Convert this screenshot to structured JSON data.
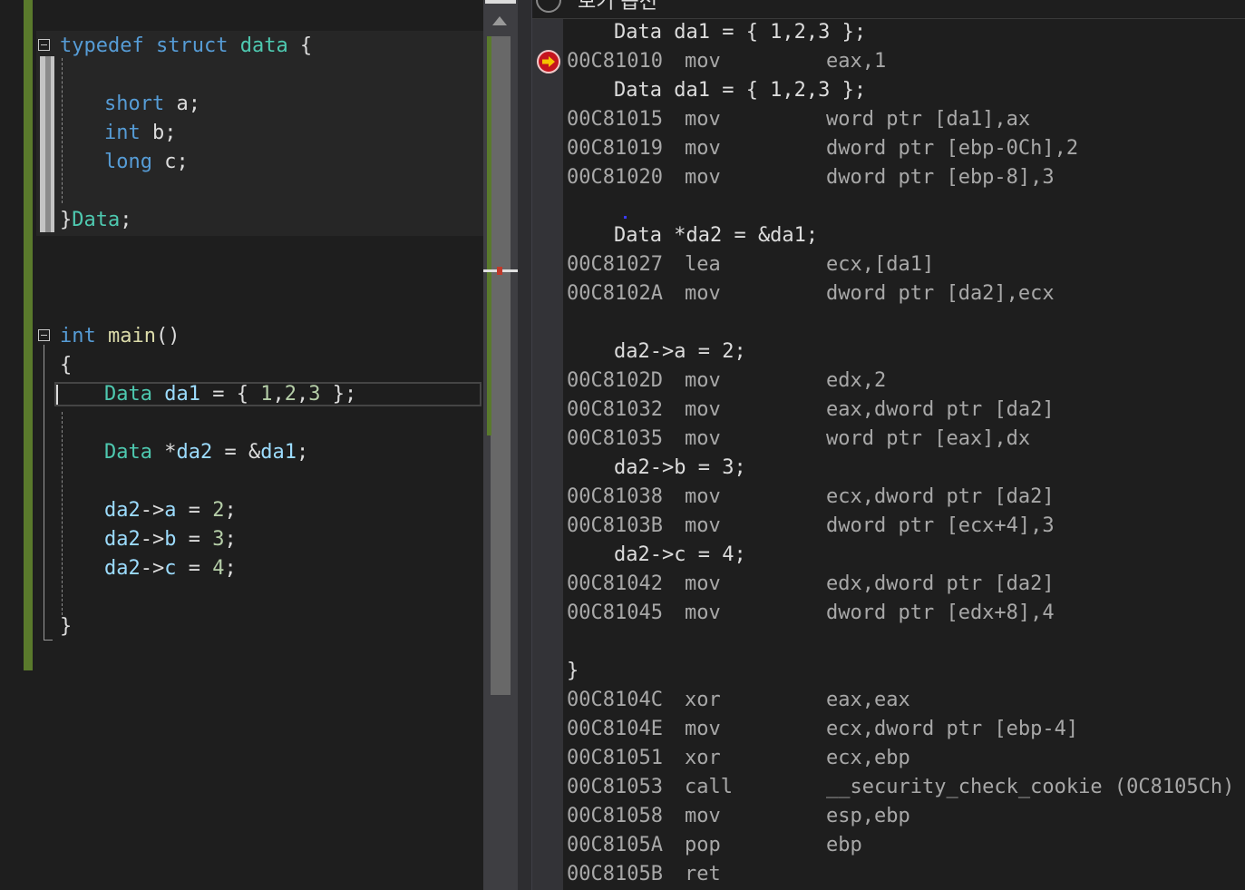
{
  "editor": {
    "lines": [
      {
        "id": "typedef",
        "tokens": [
          [
            "kw",
            "typedef"
          ],
          [
            "pl",
            " "
          ],
          [
            "kw",
            "struct"
          ],
          [
            "pl",
            " "
          ],
          [
            "ty",
            "data"
          ],
          [
            "pl",
            " {"
          ]
        ]
      },
      {
        "id": "short",
        "tokens": [
          [
            "kw",
            "short"
          ],
          [
            "pl",
            " a;"
          ]
        ]
      },
      {
        "id": "int-b",
        "tokens": [
          [
            "kw",
            "int"
          ],
          [
            "pl",
            " b;"
          ]
        ]
      },
      {
        "id": "long",
        "tokens": [
          [
            "kw",
            "long"
          ],
          [
            "pl",
            " c;"
          ]
        ]
      },
      {
        "id": "close-struct",
        "tokens": [
          [
            "pl",
            "}"
          ],
          [
            "ty",
            "Data"
          ],
          [
            "pl",
            ";"
          ]
        ]
      },
      {
        "id": "main",
        "tokens": [
          [
            "kw",
            "int"
          ],
          [
            "pl",
            " "
          ],
          [
            "fn",
            "main"
          ],
          [
            "pl",
            "()"
          ]
        ]
      },
      {
        "id": "open-brace",
        "tokens": [
          [
            "pl",
            "{"
          ]
        ]
      },
      {
        "id": "da1",
        "tokens": [
          [
            "ty",
            "Data"
          ],
          [
            "pl",
            " "
          ],
          [
            "var",
            "da1"
          ],
          [
            "pl",
            " = { "
          ],
          [
            "num",
            "1"
          ],
          [
            "pl",
            ","
          ],
          [
            "num",
            "2"
          ],
          [
            "pl",
            ","
          ],
          [
            "num",
            "3"
          ],
          [
            "pl",
            " };"
          ]
        ]
      },
      {
        "id": "da2",
        "tokens": [
          [
            "ty",
            "Data"
          ],
          [
            "pl",
            " *"
          ],
          [
            "var",
            "da2"
          ],
          [
            "pl",
            " = &"
          ],
          [
            "var",
            "da1"
          ],
          [
            "pl",
            ";"
          ]
        ]
      },
      {
        "id": "assign-a",
        "tokens": [
          [
            "var",
            "da2"
          ],
          [
            "pl",
            "->"
          ],
          [
            "var",
            "a"
          ],
          [
            "pl",
            " = "
          ],
          [
            "num",
            "2"
          ],
          [
            "pl",
            ";"
          ]
        ]
      },
      {
        "id": "assign-b",
        "tokens": [
          [
            "var",
            "da2"
          ],
          [
            "pl",
            "->"
          ],
          [
            "var",
            "b"
          ],
          [
            "pl",
            " = "
          ],
          [
            "num",
            "3"
          ],
          [
            "pl",
            ";"
          ]
        ]
      },
      {
        "id": "assign-c",
        "tokens": [
          [
            "var",
            "da2"
          ],
          [
            "pl",
            "->"
          ],
          [
            "var",
            "c"
          ],
          [
            "pl",
            " = "
          ],
          [
            "num",
            "4"
          ],
          [
            "pl",
            ";"
          ]
        ]
      },
      {
        "id": "close-main",
        "tokens": [
          [
            "pl",
            "}"
          ]
        ]
      }
    ]
  },
  "disassembly": {
    "header_label": "보기 옵션",
    "rows": [
      {
        "kind": "src",
        "text": "Data da1 = { 1,2,3 };"
      },
      {
        "kind": "asm",
        "addr": "00C81010",
        "mnemonic": "mov",
        "operands": "eax,1",
        "current": true
      },
      {
        "kind": "src",
        "text": "Data da1 = { 1,2,3 };"
      },
      {
        "kind": "asm",
        "addr": "00C81015",
        "mnemonic": "mov",
        "operands": "word ptr [da1],ax"
      },
      {
        "kind": "asm",
        "addr": "00C81019",
        "mnemonic": "mov",
        "operands": "dword ptr [ebp-0Ch],2"
      },
      {
        "kind": "asm",
        "addr": "00C81020",
        "mnemonic": "mov",
        "operands": "dword ptr [ebp-8],3"
      },
      {
        "kind": "blank"
      },
      {
        "kind": "src",
        "text": "Data *da2 = &da1;"
      },
      {
        "kind": "asm",
        "addr": "00C81027",
        "mnemonic": "lea",
        "operands": "ecx,[da1]"
      },
      {
        "kind": "asm",
        "addr": "00C8102A",
        "mnemonic": "mov",
        "operands": "dword ptr [da2],ecx"
      },
      {
        "kind": "blank"
      },
      {
        "kind": "src",
        "text": "da2->a = 2;"
      },
      {
        "kind": "asm",
        "addr": "00C8102D",
        "mnemonic": "mov",
        "operands": "edx,2"
      },
      {
        "kind": "asm",
        "addr": "00C81032",
        "mnemonic": "mov",
        "operands": "eax,dword ptr [da2]"
      },
      {
        "kind": "asm",
        "addr": "00C81035",
        "mnemonic": "mov",
        "operands": "word ptr [eax],dx"
      },
      {
        "kind": "src",
        "text": "da2->b = 3;"
      },
      {
        "kind": "asm",
        "addr": "00C81038",
        "mnemonic": "mov",
        "operands": "ecx,dword ptr [da2]"
      },
      {
        "kind": "asm",
        "addr": "00C8103B",
        "mnemonic": "mov",
        "operands": "dword ptr [ecx+4],3"
      },
      {
        "kind": "src",
        "text": "da2->c = 4;"
      },
      {
        "kind": "asm",
        "addr": "00C81042",
        "mnemonic": "mov",
        "operands": "edx,dword ptr [da2]"
      },
      {
        "kind": "asm",
        "addr": "00C81045",
        "mnemonic": "mov",
        "operands": "dword ptr [edx+8],4"
      },
      {
        "kind": "blank"
      },
      {
        "kind": "src-brace",
        "text": "}"
      },
      {
        "kind": "asm",
        "addr": "00C8104C",
        "mnemonic": "xor",
        "operands": "eax,eax"
      },
      {
        "kind": "asm",
        "addr": "00C8104E",
        "mnemonic": "mov",
        "operands": "ecx,dword ptr [ebp-4]"
      },
      {
        "kind": "asm",
        "addr": "00C81051",
        "mnemonic": "xor",
        "operands": "ecx,ebp"
      },
      {
        "kind": "asm",
        "addr": "00C81053",
        "mnemonic": "call",
        "operands": "__security_check_cookie (0C8105Ch)"
      },
      {
        "kind": "asm",
        "addr": "00C81058",
        "mnemonic": "mov",
        "operands": "esp,ebp"
      },
      {
        "kind": "asm",
        "addr": "00C8105A",
        "mnemonic": "pop",
        "operands": "ebp"
      },
      {
        "kind": "asm",
        "addr": "00C8105B",
        "mnemonic": "ret",
        "operands": ""
      }
    ]
  },
  "colors": {
    "keyword": "#569cd6",
    "type": "#4ec9b0",
    "function": "#dcdcaa",
    "variable": "#9cdcfe",
    "number": "#b5cea8",
    "change_bar": "#5a7a2c",
    "breakpoint": "#c5141e",
    "arrow": "#f5c400"
  },
  "icons": {
    "current_instruction": "current-instruction-arrow-icon",
    "fold": "collapse-minus-icon"
  }
}
